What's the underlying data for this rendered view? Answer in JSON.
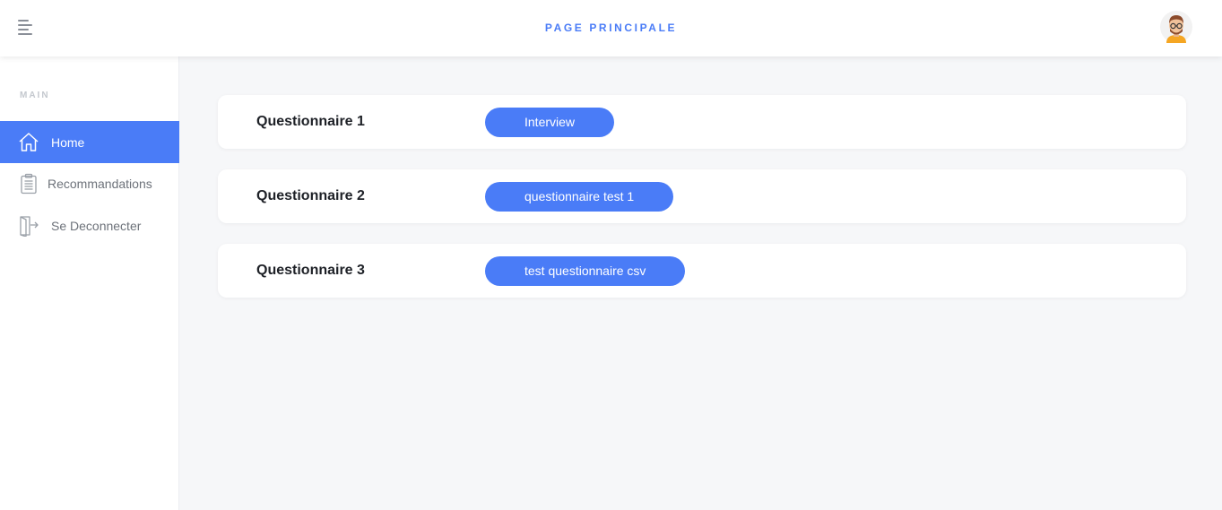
{
  "header": {
    "title": "PAGE PRINCIPALE",
    "menu_icon": "menu-icon",
    "avatar_icon": "user-avatar-icon"
  },
  "sidebar": {
    "section_label": "MAIN",
    "items": [
      {
        "label": "Home",
        "icon": "home-icon",
        "active": true
      },
      {
        "label": "Recommandations",
        "icon": "clipboard-icon",
        "active": false
      },
      {
        "label": "Se Deconnecter",
        "icon": "logout-icon",
        "active": false
      }
    ]
  },
  "questionnaires": [
    {
      "title": "Questionnaire 1",
      "button_label": "Interview"
    },
    {
      "title": "Questionnaire 2",
      "button_label": "questionnaire test 1"
    },
    {
      "title": "Questionnaire 3",
      "button_label": "test questionnaire csv"
    }
  ],
  "colors": {
    "accent": "#4a7cf7",
    "background": "#f6f7f9",
    "card": "#ffffff",
    "text_dark": "#1e2127",
    "text_muted": "#6d727a"
  }
}
